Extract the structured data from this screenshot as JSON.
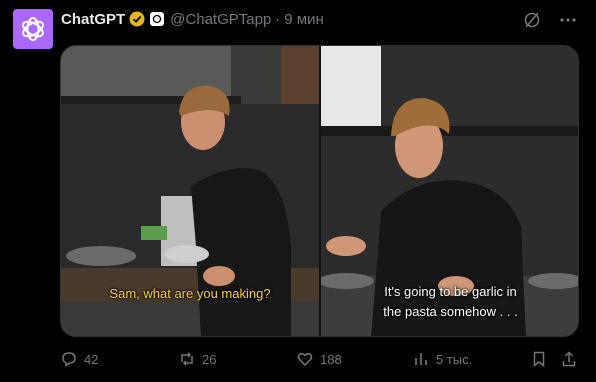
{
  "author": {
    "name": "ChatGPT",
    "handle": "@ChatGPTapp",
    "time": "9 мин"
  },
  "media": {
    "left_caption": "Sam, what are you making?",
    "right_caption_line1": "It's going to be garlic in",
    "right_caption_line2": "the pasta somehow . . ."
  },
  "actions": {
    "replies": "42",
    "reposts": "26",
    "likes": "188",
    "views": "5 тыс."
  },
  "colors": {
    "background": "#000000",
    "accent": "#ab68ff",
    "caption_yellow": "#f2d13a",
    "muted": "#71767b"
  }
}
